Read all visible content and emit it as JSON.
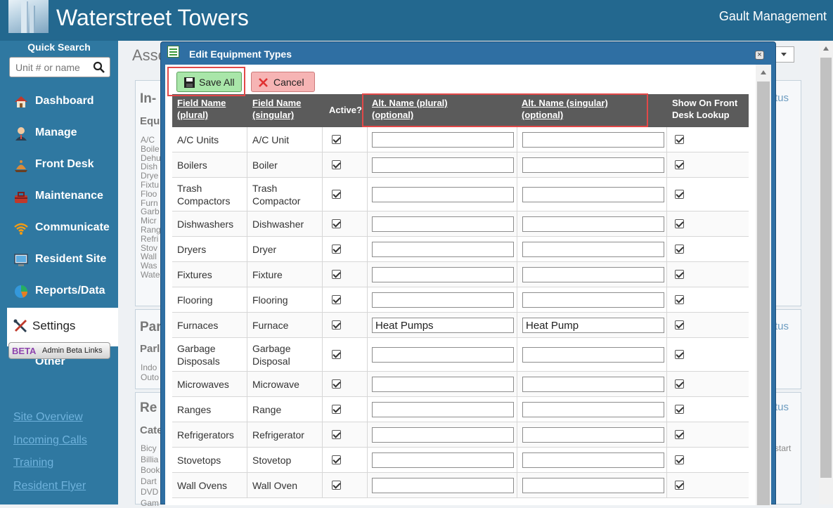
{
  "header": {
    "title": "Waterstreet Towers",
    "company": "Gault Management"
  },
  "sidebar": {
    "quick_search_label": "Quick Search",
    "quick_search_placeholder": "Unit # or name",
    "nav": [
      {
        "label": "Dashboard",
        "icon": "house-icon"
      },
      {
        "label": "Manage",
        "icon": "person-icon"
      },
      {
        "label": "Front Desk",
        "icon": "desk-bell-icon"
      },
      {
        "label": "Maintenance",
        "icon": "toolbox-icon"
      },
      {
        "label": "Communicate",
        "icon": "wifi-icon"
      },
      {
        "label": "Resident Site",
        "icon": "monitor-icon"
      },
      {
        "label": "Reports/Data",
        "icon": "pie-chart-icon"
      },
      {
        "label": "Settings",
        "icon": "tools-icon"
      },
      {
        "label": "Other",
        "icon": ""
      }
    ],
    "beta_badge": "BETA",
    "beta_label": "Admin Beta Links",
    "links": [
      "Site Overview",
      "Incoming Calls",
      "Training",
      "Resident Flyer"
    ]
  },
  "background": {
    "page_title": "Asse",
    "sections": [
      {
        "heading": "In-",
        "subheading": "Equ",
        "items": [
          "A/C",
          "Boile",
          "Dehu",
          "Dish",
          "Drye",
          "Fixtu",
          "Floo",
          "Furn",
          "Garb",
          "Micr",
          "Rang",
          "Refri",
          "Stov",
          "Wall",
          "Was",
          "Wate"
        ],
        "right": "tus"
      },
      {
        "heading": "Par",
        "subheading": "Parl",
        "items": [
          "Indo",
          "Outo"
        ],
        "right": "tus"
      },
      {
        "heading": "Re",
        "subheading": "Cate",
        "items": [
          "Bicy",
          "Billia",
          "Book",
          "Dart",
          "DVD",
          "Gam"
        ],
        "right": "tus",
        "right_note": "start"
      }
    ]
  },
  "dialog": {
    "title": "Edit Equipment Types",
    "save_label": "Save All",
    "cancel_label": "Cancel",
    "columns": {
      "field_plural": [
        "Field Name",
        "(plural)"
      ],
      "field_singular": [
        "Field Name",
        "(singular)"
      ],
      "active": "Active?",
      "alt_plural": [
        "Alt. Name (plural)",
        "(optional)"
      ],
      "alt_singular": [
        "Alt. Name (singular)",
        "(optional)"
      ],
      "front_desk": [
        "Show On Front",
        "Desk Lookup"
      ]
    },
    "rows": [
      {
        "plural": "A/C Units",
        "singular": "A/C Unit",
        "active": true,
        "alt_plural": "",
        "alt_singular": "",
        "front_desk": true
      },
      {
        "plural": "Boilers",
        "singular": "Boiler",
        "active": true,
        "alt_plural": "",
        "alt_singular": "",
        "front_desk": true
      },
      {
        "plural": [
          "Trash",
          "Compactors"
        ],
        "singular": [
          "Trash",
          "Compactor"
        ],
        "active": true,
        "alt_plural": "",
        "alt_singular": "",
        "front_desk": true
      },
      {
        "plural": "Dishwashers",
        "singular": "Dishwasher",
        "active": true,
        "alt_plural": "",
        "alt_singular": "",
        "front_desk": true
      },
      {
        "plural": "Dryers",
        "singular": "Dryer",
        "active": true,
        "alt_plural": "",
        "alt_singular": "",
        "front_desk": true
      },
      {
        "plural": "Fixtures",
        "singular": "Fixture",
        "active": true,
        "alt_plural": "",
        "alt_singular": "",
        "front_desk": true
      },
      {
        "plural": "Flooring",
        "singular": "Flooring",
        "active": true,
        "alt_plural": "",
        "alt_singular": "",
        "front_desk": true
      },
      {
        "plural": "Furnaces",
        "singular": "Furnace",
        "active": true,
        "alt_plural": "Heat Pumps",
        "alt_singular": "Heat Pump",
        "front_desk": true
      },
      {
        "plural": [
          "Garbage",
          "Disposals"
        ],
        "singular": [
          "Garbage",
          "Disposal"
        ],
        "active": true,
        "alt_plural": "",
        "alt_singular": "",
        "front_desk": true
      },
      {
        "plural": "Microwaves",
        "singular": "Microwave",
        "active": true,
        "alt_plural": "",
        "alt_singular": "",
        "front_desk": true
      },
      {
        "plural": "Ranges",
        "singular": "Range",
        "active": true,
        "alt_plural": "",
        "alt_singular": "",
        "front_desk": true
      },
      {
        "plural": "Refrigerators",
        "singular": "Refrigerator",
        "active": true,
        "alt_plural": "",
        "alt_singular": "",
        "front_desk": true
      },
      {
        "plural": "Stovetops",
        "singular": "Stovetop",
        "active": true,
        "alt_plural": "",
        "alt_singular": "",
        "front_desk": true
      },
      {
        "plural": "Wall Ovens",
        "singular": "Wall Oven",
        "active": true,
        "alt_plural": "",
        "alt_singular": "",
        "front_desk": true
      }
    ]
  },
  "colors": {
    "header_bg": "#23688f",
    "sidebar_bg": "#2f78a1",
    "dialog_frame": "#2f6fa3",
    "table_header": "#5b5b5b",
    "highlight": "#e24848"
  }
}
